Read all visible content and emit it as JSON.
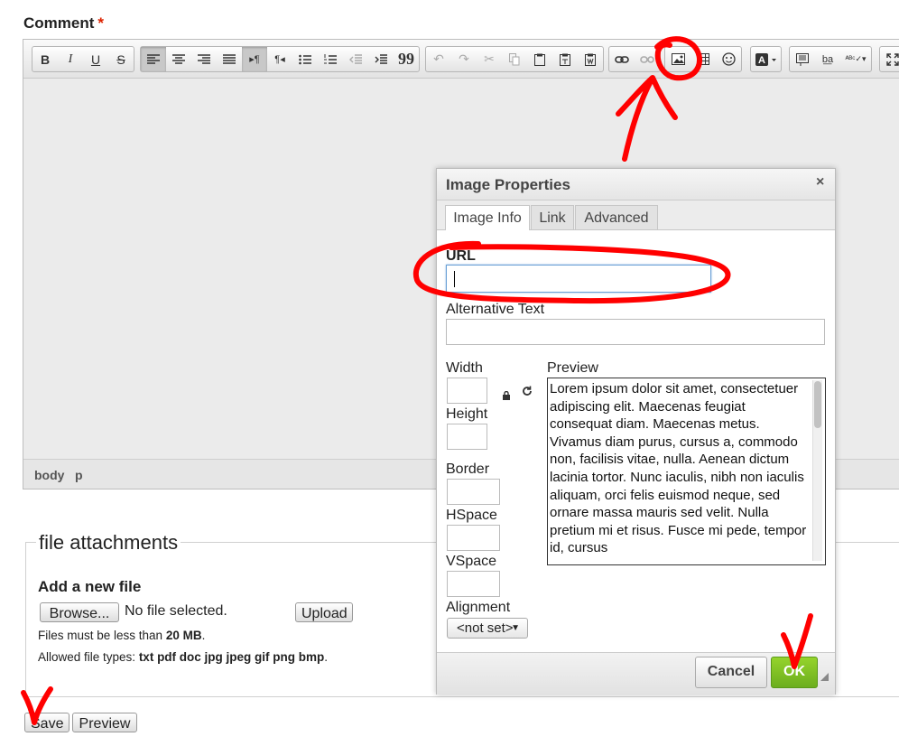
{
  "form": {
    "comment_label": "Comment",
    "required_marker": "*"
  },
  "editor": {
    "statusbar": {
      "path1": "body",
      "path2": "p"
    },
    "toolbar_icons": {
      "bold": "B",
      "italic": "I",
      "underline": "U",
      "strike": "S",
      "blockquote": "99",
      "show_blocks": "¶"
    }
  },
  "dialog": {
    "title": "Image Properties",
    "close": "×",
    "tabs": [
      "Image Info",
      "Link",
      "Advanced"
    ],
    "url_label": "URL",
    "url_value": "",
    "alt_label": "Alternative Text",
    "width_label": "Width",
    "height_label": "Height",
    "border_label": "Border",
    "hspace_label": "HSpace",
    "vspace_label": "VSpace",
    "alignment_label": "Alignment",
    "alignment_value": "<not set>",
    "preview_label": "Preview",
    "preview_text": "Lorem ipsum dolor sit amet, consectetuer adipiscing elit. Maecenas feugiat consequat diam. Maecenas metus. Vivamus diam purus, cursus a, commodo non, facilisis vitae, nulla. Aenean dictum lacinia tortor. Nunc iaculis, nibh non iaculis aliquam, orci felis euismod neque, sed ornare massa mauris sed velit. Nulla pretium mi et risus. Fusce mi pede, tempor id, cursus",
    "cancel_label": "Cancel",
    "ok_label": "OK"
  },
  "attachments": {
    "legend": "file attachments",
    "add_title": "Add a new file",
    "browse_label": "Browse...",
    "no_file": "No file selected.",
    "upload_label": "Upload",
    "size_prefix": "Files must be less than ",
    "size_value": "20 MB",
    "size_suffix": ".",
    "types_prefix": "Allowed file types: ",
    "types_value": "txt pdf doc jpg jpeg gif png bmp",
    "types_suffix": "."
  },
  "actions": {
    "save_label": "Save",
    "preview_label": "Preview"
  },
  "colors": {
    "annotation": "#ff0000",
    "ok_button": "#7cbf22",
    "required": "#dd2200"
  }
}
